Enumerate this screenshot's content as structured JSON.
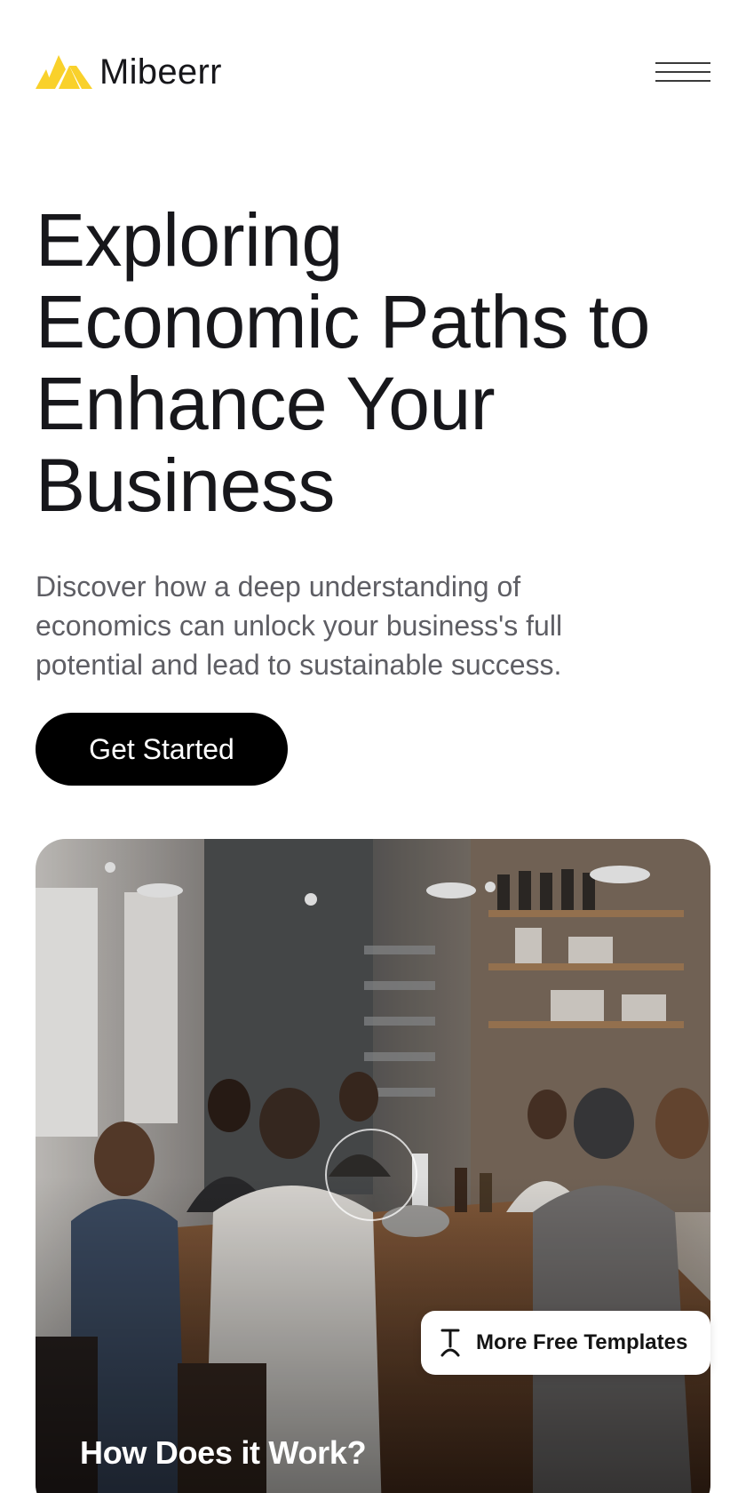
{
  "header": {
    "brand": "Mibeerr",
    "logo_icon": "mountain-logo-icon",
    "menu_icon": "hamburger-menu-icon"
  },
  "hero": {
    "title_lines": [
      "Exploring",
      "Economic Paths to",
      "Enhance Your",
      "Business"
    ],
    "subtitle_lines": [
      "Discover how a deep understanding of",
      "economics can unlock your business's full",
      "potential and lead to sustainable success."
    ],
    "cta_label": "Get Started"
  },
  "media": {
    "play_icon": "play-ring-icon",
    "caption": "How Does it Work?"
  },
  "badge": {
    "label": "More Free Templates",
    "icon": "template-logo-icon"
  },
  "colors": {
    "accent": "#f9d12b",
    "text": "#17171b",
    "muted": "#5e5e64",
    "button": "#000000"
  }
}
